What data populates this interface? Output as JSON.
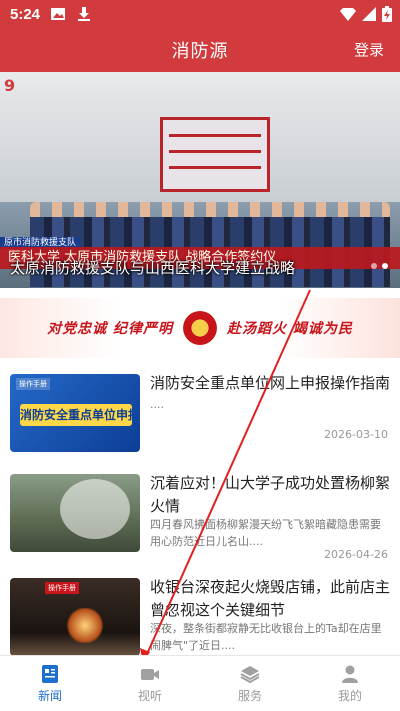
{
  "status_bar": {
    "time": "5:24"
  },
  "header": {
    "title": "消防源",
    "login": "登录",
    "bg_color": "#d13b3d"
  },
  "banner": {
    "caption": "太原消防救援支队与山西医科大学建立战略",
    "strip_text": "医科大学 太原市消防救援支队 战略合作签约仪",
    "org_tag": "原市消防救援支队",
    "logo_text": "9",
    "dots": 2
  },
  "slogan": {
    "left": "对党忠诚 纪律严明",
    "right": "赴汤蹈火 竭诚为民"
  },
  "news": [
    {
      "title": "消防安全重点单位网上申报操作指南",
      "subtitle": "....",
      "date": "2026-03-10",
      "thumb_tag": "操作手册",
      "thumb_text": "消防安全重点单位申报"
    },
    {
      "title": "沉着应对！山大学子成功处置杨柳絮火情",
      "subtitle": "四月春风拂面杨柳絮漫天纷飞飞絮暗藏隐患需要用心防范近日儿名山....",
      "date": "2026-04-26"
    },
    {
      "title": "收银台深夜起火烧毁店铺，此前店主曾忽视这个关键细节",
      "subtitle": "深夜，整条街都寂静无比收银台上的Ta却在店里闹脾气\"了近日....",
      "date": "2026-04-25",
      "thumb_tag": "操作手册"
    }
  ],
  "tabs": [
    {
      "label": "新闻",
      "icon": "news-icon",
      "active": true
    },
    {
      "label": "视听",
      "icon": "video-icon",
      "active": false
    },
    {
      "label": "服务",
      "icon": "layers-icon",
      "active": false
    },
    {
      "label": "我的",
      "icon": "profile-icon",
      "active": false
    }
  ],
  "colors": {
    "active_tab": "#1f6fd1",
    "inactive_tab": "#999999",
    "accent_red": "#d13b3d"
  }
}
